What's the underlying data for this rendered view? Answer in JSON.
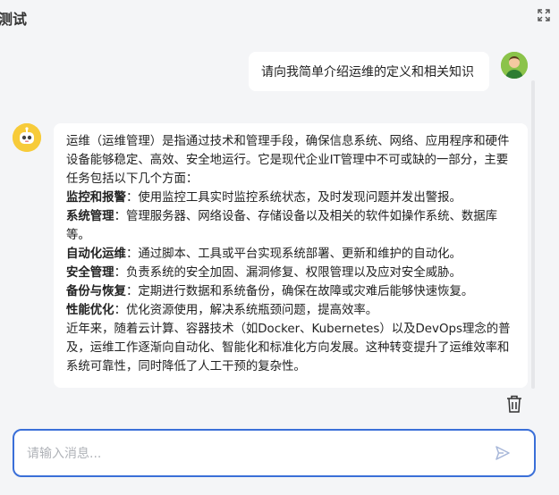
{
  "header": {
    "title": "测试",
    "expand_icon": "expand-icon"
  },
  "chat": {
    "user_message": "请向我简单介绍运维的定义和相关知识",
    "bot_message": {
      "intro": "运维（运维管理）是指通过技术和管理手段，确保信息系统、网络、应用程序和硬件设备能够稳定、高效、安全地运行。它是现代企业IT管理中不可或缺的一部分，主要任务包括以下几个方面：",
      "items": [
        {
          "term": "监控和报警",
          "desc": "：使用监控工具实时监控系统状态，及时发现问题并发出警报。"
        },
        {
          "term": "系统管理",
          "desc": "：管理服务器、网络设备、存储设备以及相关的软件如操作系统、数据库等。"
        },
        {
          "term": "自动化运维",
          "desc": "：通过脚本、工具或平台实现系统部署、更新和维护的自动化。"
        },
        {
          "term": "安全管理",
          "desc": "：负责系统的安全加固、漏洞修复、权限管理以及应对安全威胁。"
        },
        {
          "term": "备份与恢复",
          "desc": "：定期进行数据和系统备份，确保在故障或灾难后能够快速恢复。"
        },
        {
          "term": "性能优化",
          "desc": "：优化资源使用，解决系统瓶颈问题，提高效率。"
        }
      ],
      "outro": "近年来，随着云计算、容器技术（如Docker、Kubernetes）以及DevOps理念的普及，运维工作逐渐向自动化、智能化和标准化方向发展。这种转变提升了运维效率和系统可靠性，同时降低了人工干预的复杂性。"
    }
  },
  "input": {
    "placeholder": "请输入消息...",
    "value": ""
  },
  "colors": {
    "accent": "#3a6fd8",
    "send_icon": "#a7b7d9",
    "bot_avatar": "#f7cb3a",
    "user_avatar": "#8bc34a"
  }
}
